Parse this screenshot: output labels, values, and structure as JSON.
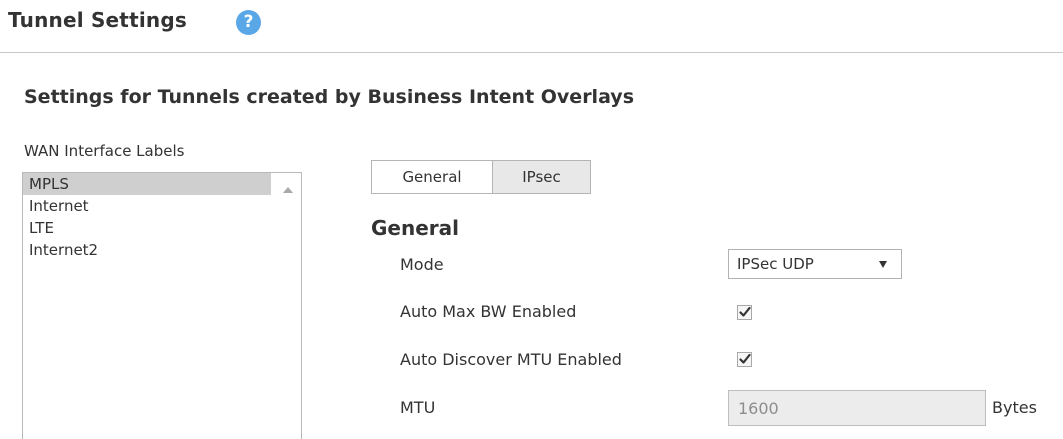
{
  "header": {
    "title": "Tunnel Settings",
    "help_glyph": "?",
    "help_icon": "help-circle-icon"
  },
  "section": {
    "title": "Settings for Tunnels created by Business Intent Overlays"
  },
  "wan_labels": {
    "label": "WAN Interface Labels",
    "items": [
      "MPLS",
      "Internet",
      "LTE",
      "Internet2"
    ],
    "selected": "MPLS"
  },
  "tabs": {
    "general": "General",
    "ipsec": "IPsec",
    "active": "General"
  },
  "general": {
    "heading": "General",
    "mode_label": "Mode",
    "mode_value": "IPSec UDP",
    "auto_max_bw_label": "Auto Max BW Enabled",
    "auto_max_bw_checked": true,
    "auto_mtu_label": "Auto Discover MTU Enabled",
    "auto_mtu_checked": true,
    "mtu_label": "MTU",
    "mtu_value": "1600",
    "mtu_unit": "Bytes"
  },
  "colors": {
    "help_icon": "#5aa7e8",
    "selected_item": "#cfcfcf",
    "disabled_input": "#ececec",
    "header_rule": "#c8c8c8"
  }
}
